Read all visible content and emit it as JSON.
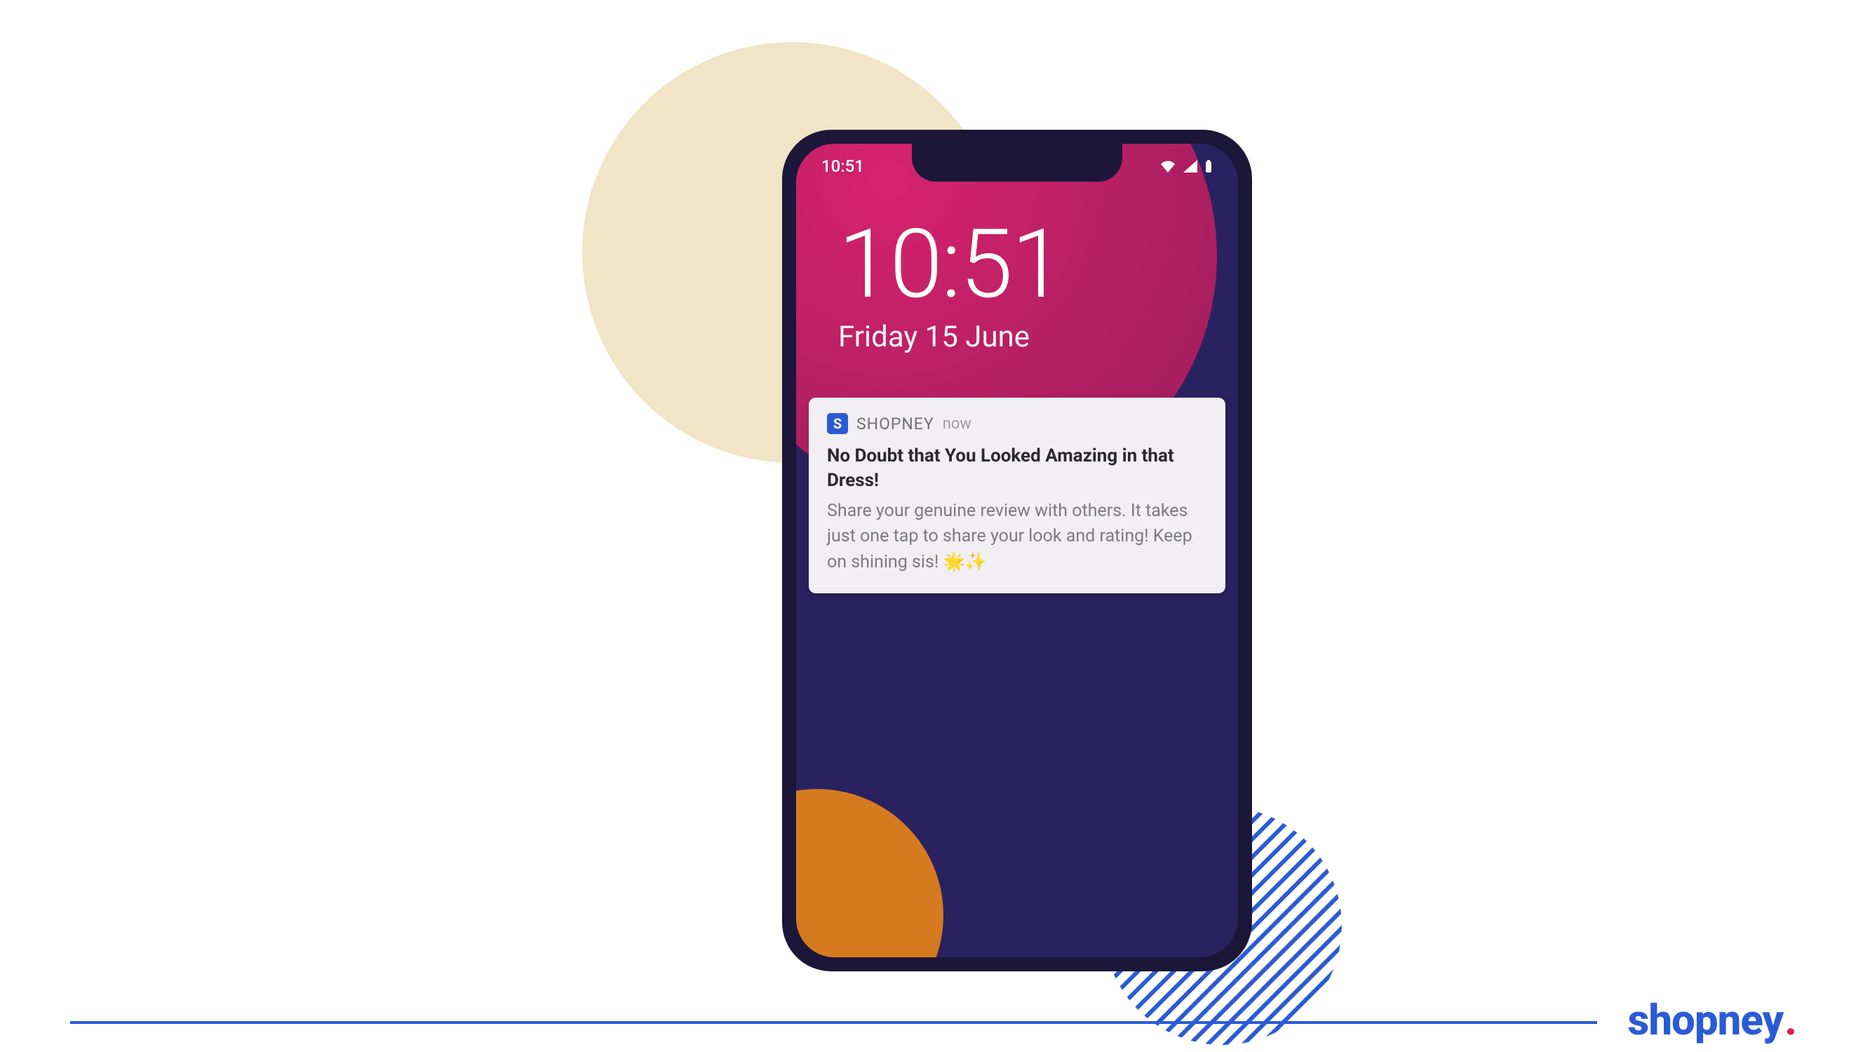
{
  "status_bar": {
    "time": "10:51"
  },
  "lockscreen": {
    "time": "10:51",
    "date": "Friday 15 June"
  },
  "notification": {
    "app_icon_letter": "S",
    "app_name": "SHOPNEY",
    "time_ago": "now",
    "title": "No Doubt that You Looked Amazing in that Dress!",
    "body": "Share your genuine review with others. It takes just one tap to share your look and rating! Keep on shining sis! 🌟✨"
  },
  "brand": {
    "name": "shopney",
    "dot": "."
  }
}
